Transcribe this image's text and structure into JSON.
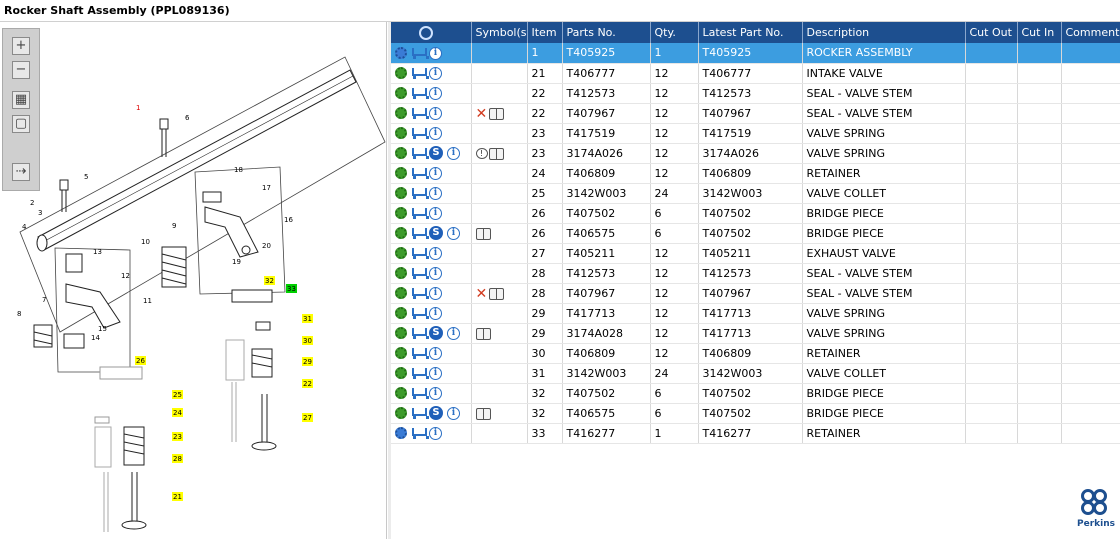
{
  "title": "Rocker Shaft Assembly (PPL089136)",
  "toolbar": {
    "zoom_in_glyph": "+",
    "zoom_out_glyph": "−",
    "fit_glyph": "▦",
    "box_glyph": "▢",
    "list_glyph": "⇢"
  },
  "table": {
    "columns": [
      "",
      "Symbol(s)",
      "Item",
      "Parts No.",
      "Qty.",
      "Latest Part No.",
      "Description",
      "Cut Out",
      "Cut In",
      "Comment"
    ],
    "rows": [
      {
        "icons": [
          "gear-blue",
          "cart",
          "info"
        ],
        "symbols": [],
        "item": "1",
        "part": "T405925",
        "qty": "1",
        "latest": "T405925",
        "desc": "ROCKER ASSEMBLY",
        "selected": true
      },
      {
        "icons": [
          "gear",
          "cart",
          "info"
        ],
        "symbols": [],
        "item": "21",
        "part": "T406777",
        "qty": "12",
        "latest": "T406777",
        "desc": "INTAKE VALVE"
      },
      {
        "icons": [
          "gear",
          "cart",
          "info"
        ],
        "symbols": [],
        "item": "22",
        "part": "T412573",
        "qty": "12",
        "latest": "T412573",
        "desc": "SEAL - VALVE STEM"
      },
      {
        "icons": [
          "gear",
          "cart",
          "info"
        ],
        "symbols": [
          "x",
          "book"
        ],
        "item": "22",
        "part": "T407967",
        "qty": "12",
        "latest": "T407967",
        "desc": "SEAL - VALVE STEM"
      },
      {
        "icons": [
          "gear",
          "cart",
          "info"
        ],
        "symbols": [],
        "item": "23",
        "part": "T417519",
        "qty": "12",
        "latest": "T417519",
        "desc": "VALVE SPRING"
      },
      {
        "icons": [
          "gear",
          "cart",
          "s",
          "info"
        ],
        "symbols": [
          "bubble",
          "book"
        ],
        "item": "23",
        "part": "3174A026",
        "qty": "12",
        "latest": "3174A026",
        "desc": "VALVE SPRING"
      },
      {
        "icons": [
          "gear",
          "cart",
          "info"
        ],
        "symbols": [],
        "item": "24",
        "part": "T406809",
        "qty": "12",
        "latest": "T406809",
        "desc": "RETAINER"
      },
      {
        "icons": [
          "gear",
          "cart",
          "info"
        ],
        "symbols": [],
        "item": "25",
        "part": "3142W003",
        "qty": "24",
        "latest": "3142W003",
        "desc": "VALVE COLLET"
      },
      {
        "icons": [
          "gear",
          "cart",
          "info"
        ],
        "symbols": [],
        "item": "26",
        "part": "T407502",
        "qty": "6",
        "latest": "T407502",
        "desc": "BRIDGE PIECE"
      },
      {
        "icons": [
          "gear",
          "cart",
          "s",
          "info"
        ],
        "symbols": [
          "book"
        ],
        "item": "26",
        "part": "T406575",
        "qty": "6",
        "latest": "T407502",
        "desc": "BRIDGE PIECE"
      },
      {
        "icons": [
          "gear",
          "cart",
          "info"
        ],
        "symbols": [],
        "item": "27",
        "part": "T405211",
        "qty": "12",
        "latest": "T405211",
        "desc": "EXHAUST VALVE"
      },
      {
        "icons": [
          "gear",
          "cart",
          "info"
        ],
        "symbols": [],
        "item": "28",
        "part": "T412573",
        "qty": "12",
        "latest": "T412573",
        "desc": "SEAL - VALVE STEM"
      },
      {
        "icons": [
          "gear",
          "cart",
          "info"
        ],
        "symbols": [
          "x",
          "book"
        ],
        "item": "28",
        "part": "T407967",
        "qty": "12",
        "latest": "T407967",
        "desc": "SEAL - VALVE STEM"
      },
      {
        "icons": [
          "gear",
          "cart",
          "info"
        ],
        "symbols": [],
        "item": "29",
        "part": "T417713",
        "qty": "12",
        "latest": "T417713",
        "desc": "VALVE SPRING"
      },
      {
        "icons": [
          "gear",
          "cart",
          "s",
          "info"
        ],
        "symbols": [
          "book"
        ],
        "item": "29",
        "part": "3174A028",
        "qty": "12",
        "latest": "T417713",
        "desc": "VALVE SPRING"
      },
      {
        "icons": [
          "gear",
          "cart",
          "info"
        ],
        "symbols": [],
        "item": "30",
        "part": "T406809",
        "qty": "12",
        "latest": "T406809",
        "desc": "RETAINER"
      },
      {
        "icons": [
          "gear",
          "cart",
          "info"
        ],
        "symbols": [],
        "item": "31",
        "part": "3142W003",
        "qty": "24",
        "latest": "3142W003",
        "desc": "VALVE COLLET"
      },
      {
        "icons": [
          "gear",
          "cart",
          "info"
        ],
        "symbols": [],
        "item": "32",
        "part": "T407502",
        "qty": "6",
        "latest": "T407502",
        "desc": "BRIDGE PIECE"
      },
      {
        "icons": [
          "gear",
          "cart",
          "s",
          "info"
        ],
        "symbols": [
          "book"
        ],
        "item": "32",
        "part": "T406575",
        "qty": "6",
        "latest": "T407502",
        "desc": "BRIDGE PIECE"
      },
      {
        "icons": [
          "gear-blue",
          "cart",
          "info"
        ],
        "symbols": [],
        "item": "33",
        "part": "T416277",
        "qty": "1",
        "latest": "T416277",
        "desc": "RETAINER"
      }
    ]
  },
  "diagram": {
    "callouts": [
      "1",
      "2",
      "3",
      "4",
      "5",
      "6",
      "7",
      "8",
      "9",
      "10",
      "11",
      "12",
      "13",
      "14",
      "15",
      "16",
      "17",
      "18",
      "19",
      "20"
    ],
    "highlighted_callouts": [
      "21",
      "22",
      "23",
      "24",
      "25",
      "26",
      "27",
      "28",
      "29",
      "30",
      "31",
      "32",
      "33"
    ]
  },
  "logo": {
    "text": "Perkins"
  },
  "colors": {
    "header": "#1d4f8f",
    "selected": "#3c9de0",
    "callout_highlight": "#ffff00",
    "callout_active": "#00d000"
  }
}
